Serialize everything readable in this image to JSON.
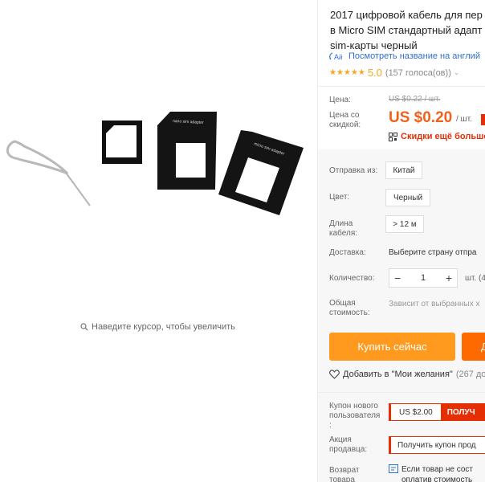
{
  "gallery": {
    "zoom_hint": "Наведите курсор, чтобы увеличить",
    "adapter_nano_label": "nano sim adapter",
    "adapter_micro_label": "micro sim adapter"
  },
  "product": {
    "title_line1": "2017 цифровой кабель для пер",
    "title_line2": "в Micro SIM стандартный адапт",
    "title_line3": "sim-карты черный",
    "translate_link": "Посмотреть название на англий",
    "rating_value": "5.0",
    "votes": "(157 голоса(ов))"
  },
  "price": {
    "price_label": "Цена:",
    "old_price": "US $0.22 / шт.",
    "discount_label_1": "Цена со",
    "discount_label_2": "скидкой:",
    "new_price": "US $0.20",
    "per_unit": "/ шт.",
    "app_discount": "Скидки ещё больше"
  },
  "options": {
    "shipping_from_label": "Отправка из:",
    "shipping_from_value": "Китай",
    "color_label": "Цвет:",
    "color_value": "Черный",
    "length_label_1": "Длина",
    "length_label_2": "кабеля:",
    "length_value": "> 12 м",
    "delivery_label": "Доставка:",
    "delivery_value": "Выберите страну отпра",
    "quantity_label": "Количество:",
    "quantity_value": "1",
    "quantity_unit": "шт. (4",
    "total_label_1": "Общая",
    "total_label_2": "стоимость:",
    "total_value": "Зависит от выбранных х"
  },
  "actions": {
    "buy_now": "Купить сейчас",
    "add_to_cart": "Д",
    "wishlist": "Добавить в \"Мои желания\"",
    "wishlist_count": "(267 до"
  },
  "coupons": {
    "new_user_label_1": "Купон нового",
    "new_user_label_2": "пользователя",
    "new_user_label_3": ":",
    "new_user_amount": "US $2.00",
    "new_user_get": "ПОЛУЧ",
    "seller_label_1": "Акция",
    "seller_label_2": "продавца:",
    "seller_coupon": "Получить купон прод",
    "return_label_1": "Возврат",
    "return_label_2": "товара",
    "return_text_1": "Если товар не сост",
    "return_text_2": "оплатив стоимость"
  },
  "colors": {
    "accent": "#f0611d",
    "buy": "#ff9a1e",
    "cart": "#ff6a00",
    "coupon_red": "#e62e04",
    "link": "#2f6fcf"
  }
}
